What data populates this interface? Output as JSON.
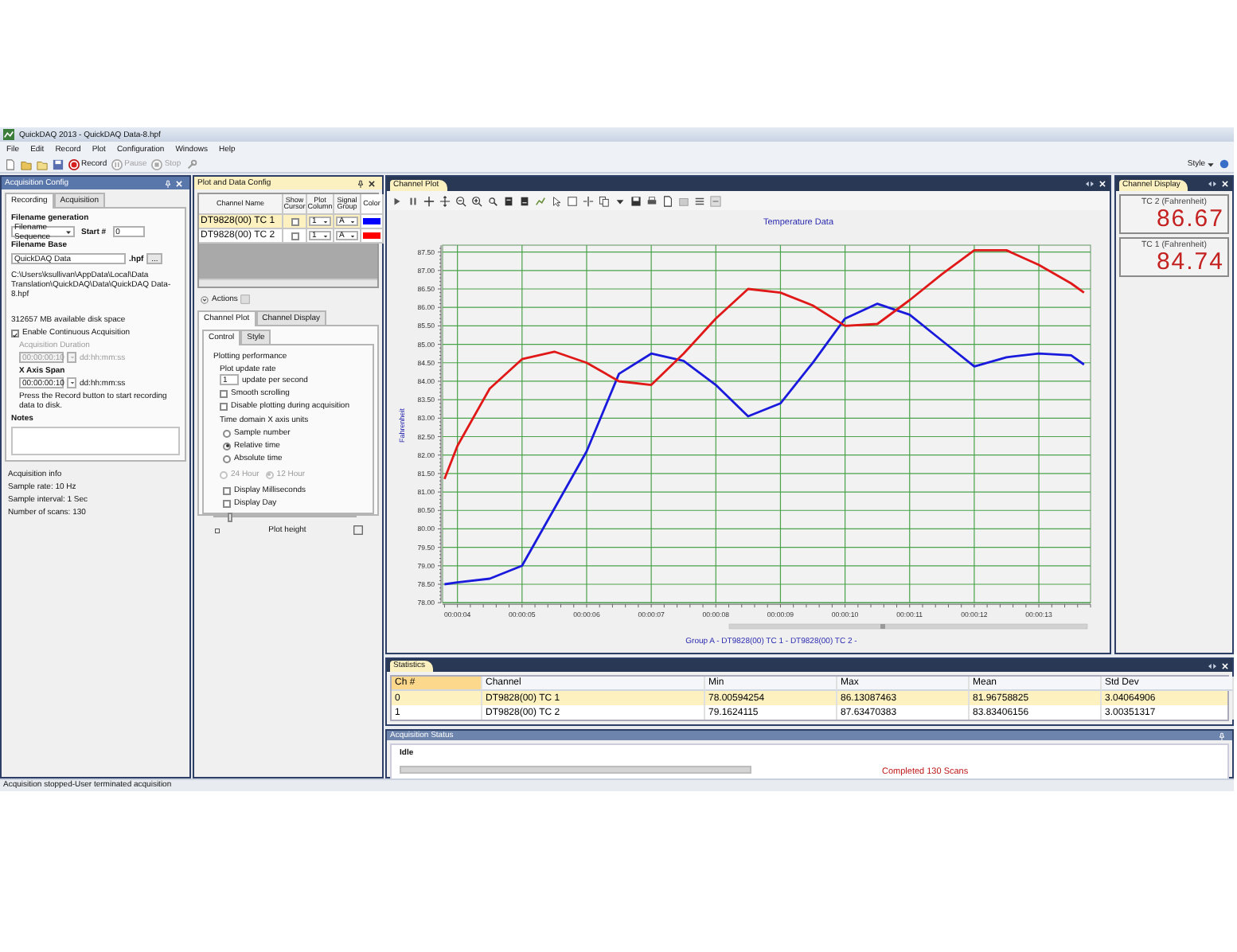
{
  "window": {
    "title": "QuickDAQ 2013 - QuickDAQ Data-8.hpf"
  },
  "menu": [
    "File",
    "Edit",
    "Record",
    "Plot",
    "Configuration",
    "Windows",
    "Help"
  ],
  "toolbar": {
    "buttons": [
      {
        "label": "Record",
        "disabled": false
      },
      {
        "label": "Pause",
        "disabled": true
      },
      {
        "label": "Stop",
        "disabled": true
      }
    ],
    "style_menu": "Style"
  },
  "acquisition_config": {
    "title": "Acquisition Config",
    "tabs": [
      {
        "label": "Recording",
        "selected": true
      },
      {
        "label": "Acquisition",
        "selected": false
      }
    ],
    "filename_generation": {
      "label": "Filename generation",
      "value": "Filename Sequence"
    },
    "start": {
      "label": "Start #",
      "value": "0"
    },
    "filename_base": {
      "label": "Filename Base",
      "value": "QuickDAQ Data",
      "extension": ".hpf",
      "browse": "..."
    },
    "path": "C:\\Users\\ksullivan\\AppData\\Local\\Data Translation\\QuickDAQ\\Data\\QuickDAQ Data-8.hpf",
    "disk_space": "312657 MB available disk space",
    "continuous": {
      "label": "Enable Continuous Acquisition",
      "checked": true
    },
    "duration": {
      "label": "Acquisition Duration",
      "value": "00:00:00:10",
      "format": "dd:hh:mm:ss",
      "disabled": true
    },
    "x_axis_span": {
      "label": "X Axis Span",
      "value": "00:00:00:10",
      "format": "dd:hh:mm:ss",
      "disabled": false
    },
    "hint": "Press the Record button to start recording data to disk.",
    "notes": {
      "label": "Notes"
    },
    "info": [
      "Acquisition info",
      "Sample rate: 10 Hz",
      "Sample interval: 1 Sec",
      "Number of scans: 130"
    ]
  },
  "plot_config": {
    "title": "Plot and Data Config",
    "columns": [
      "Channel Name",
      "Show Cursor",
      "Plot Column",
      "Signal Group",
      "Color"
    ],
    "rows": [
      {
        "name": "DT9828(00) TC 1",
        "show_cursor": false,
        "plot_column": "1",
        "signal_group": "A",
        "color": "#0000ff",
        "selected": true
      },
      {
        "name": "DT9828(00) TC 2",
        "show_cursor": false,
        "plot_column": "1",
        "signal_group": "A",
        "color": "#ff0000",
        "selected": false
      }
    ],
    "actions": "Actions",
    "tabs": [
      {
        "label": "Channel Plot",
        "selected": true
      },
      {
        "label": "Channel Display",
        "selected": false
      }
    ],
    "subtabs": [
      {
        "label": "Control",
        "selected": true
      },
      {
        "label": "Style",
        "selected": false
      }
    ],
    "section": "Plotting performance",
    "update_rate": {
      "label": "Plot update rate",
      "value": "1",
      "unit": "update per second"
    },
    "options": [
      {
        "label": "Smooth scrolling",
        "checked": false
      },
      {
        "label": "Disable plotting during acquisition",
        "checked": false
      }
    ],
    "x_units": {
      "label": "Time domain X axis units",
      "options": [
        {
          "label": "Sample number",
          "selected": false
        },
        {
          "label": "Relative time",
          "selected": true
        },
        {
          "label": "Absolute time",
          "selected": false
        }
      ]
    },
    "clock": {
      "disabled": true,
      "options": [
        {
          "label": "24 Hour",
          "selected": false
        },
        {
          "label": "12 Hour",
          "selected": true
        }
      ]
    },
    "display_options": [
      {
        "label": "Display Milliseconds",
        "checked": false
      },
      {
        "label": "Display Day",
        "checked": false
      }
    ],
    "plot_height": {
      "label": "Plot height",
      "level": 0.1
    }
  },
  "channel_plot": {
    "title": "Channel Plot",
    "chart_data": {
      "type": "line",
      "title": "Temperature Data",
      "xlabel": "Group A - DT9828(00) TC 1 - DT9828(00) TC 2 -",
      "ylabel": "Fahrenheit",
      "x": [
        3.8,
        4,
        4.5,
        5,
        5.5,
        6,
        6.5,
        7,
        7.5,
        8,
        8.5,
        9,
        9.5,
        10,
        10.5,
        11,
        11.5,
        12,
        12.5,
        13,
        13.5,
        13.7
      ],
      "grid": true,
      "series": [
        {
          "color": "#1a1adc",
          "values": [
            78.5,
            78.55,
            78.65,
            79.0,
            80.55,
            82.1,
            84.2,
            84.75,
            84.55,
            83.9,
            83.05,
            83.4,
            84.5,
            85.7,
            86.1,
            85.8,
            85.1,
            84.4,
            84.65,
            84.75,
            84.7,
            84.45
          ]
        },
        {
          "color": "#e01818",
          "values": [
            81.35,
            82.25,
            83.8,
            84.6,
            84.8,
            84.5,
            84.0,
            83.9,
            84.75,
            85.7,
            86.5,
            86.4,
            86.05,
            85.5,
            85.55,
            86.2,
            86.9,
            87.55,
            87.55,
            87.15,
            86.65,
            86.4
          ]
        }
      ],
      "xlim": [
        3.77,
        13.8
      ],
      "ylim": [
        78,
        87.6
      ],
      "xticks": [
        {
          "value": 4,
          "label": "00:00:04"
        },
        {
          "value": 5,
          "label": "00:00:05"
        },
        {
          "value": 6,
          "label": "00:00:06"
        },
        {
          "value": 7,
          "label": "00:00:07"
        },
        {
          "value": 8,
          "label": "00:00:08"
        },
        {
          "value": 9,
          "label": "00:00:09"
        },
        {
          "value": 10,
          "label": "00:00:10"
        },
        {
          "value": 11,
          "label": "00:00:11"
        },
        {
          "value": 12,
          "label": "00:00:12"
        },
        {
          "value": 13,
          "label": "00:00:13"
        }
      ],
      "yticks": [
        {
          "value": 78,
          "label": "78.00"
        },
        {
          "value": 78.5,
          "label": "78.50"
        },
        {
          "value": 79,
          "label": "79.00"
        },
        {
          "value": 79.5,
          "label": "79.50"
        },
        {
          "value": 80,
          "label": "80.00"
        },
        {
          "value": 80.5,
          "label": "80.50"
        },
        {
          "value": 81,
          "label": "81.00"
        },
        {
          "value": 81.5,
          "label": "81.50"
        },
        {
          "value": 82,
          "label": "82.00"
        },
        {
          "value": 82.5,
          "label": "82.50"
        },
        {
          "value": 83,
          "label": "83.00"
        },
        {
          "value": 83.5,
          "label": "83.50"
        },
        {
          "value": 84,
          "label": "84.00"
        },
        {
          "value": 84.5,
          "label": "84.50"
        },
        {
          "value": 85,
          "label": "85.00"
        },
        {
          "value": 85.5,
          "label": "85.50"
        },
        {
          "value": 86,
          "label": "86.00"
        },
        {
          "value": 86.5,
          "label": "86.50"
        },
        {
          "value": 87,
          "label": "87.00"
        },
        {
          "value": 87.5,
          "label": "87.50"
        }
      ]
    }
  },
  "channel_display": {
    "title": "Channel Display",
    "readouts": [
      {
        "label": "TC 2 (Fahrenheit)",
        "value": "86.67"
      },
      {
        "label": "TC 1 (Fahrenheit)",
        "value": "84.74"
      }
    ]
  },
  "statistics": {
    "title": "Statistics",
    "columns": [
      "Ch #",
      "Channel",
      "Min",
      "Max",
      "Mean",
      "Std Dev"
    ],
    "rows": [
      {
        "cells": [
          "0",
          "DT9828(00) TC 1",
          "78.00594254",
          "86.13087463",
          "81.96758825",
          "3.04064906"
        ],
        "selected": true
      },
      {
        "cells": [
          "1",
          "DT9828(00) TC 2",
          "79.1624115",
          "87.63470383",
          "83.83406156",
          "3.00351317"
        ],
        "selected": false
      }
    ]
  },
  "acquisition_status": {
    "title": "Acquisition Status",
    "state": "Idle",
    "level": 0,
    "message": "Completed 130 Scans"
  },
  "status_bar": "Acquisition stopped-User terminated acquisition"
}
